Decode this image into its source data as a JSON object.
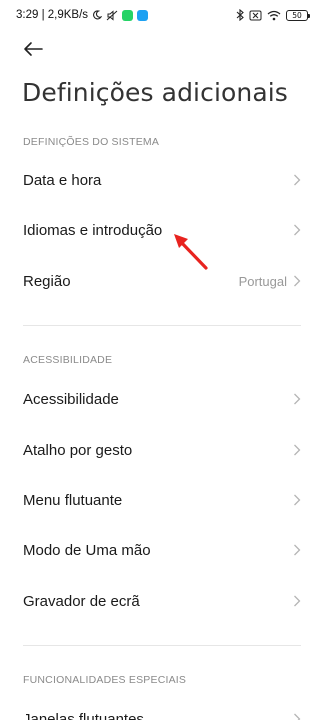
{
  "status_bar": {
    "time_speed": "3:29 | 2,9KB/s",
    "battery": "50",
    "colors": {
      "whatsapp": "#25D366",
      "twitter": "#1DA1F2"
    }
  },
  "header": {
    "back_icon": "arrow-left-icon",
    "title": "Definições adicionais"
  },
  "sections": {
    "system": {
      "header": "DEFINIÇÕES DO SISTEMA",
      "items": [
        {
          "label": "Data e hora"
        },
        {
          "label": "Idiomas e introdução"
        },
        {
          "label": "Região",
          "value": "Portugal"
        }
      ]
    },
    "accessibility": {
      "header": "ACESSIBILIDADE",
      "items": [
        {
          "label": "Acessibilidade"
        },
        {
          "label": "Atalho por gesto"
        },
        {
          "label": "Menu flutuante"
        },
        {
          "label": "Modo de Uma mão"
        },
        {
          "label": "Gravador de ecrã"
        }
      ]
    },
    "special": {
      "header": "FUNCIONALIDADES ESPECIAIS",
      "items": [
        {
          "label": "Janelas flutuantes"
        }
      ]
    }
  },
  "annotation": {
    "color": "#e8231f"
  }
}
